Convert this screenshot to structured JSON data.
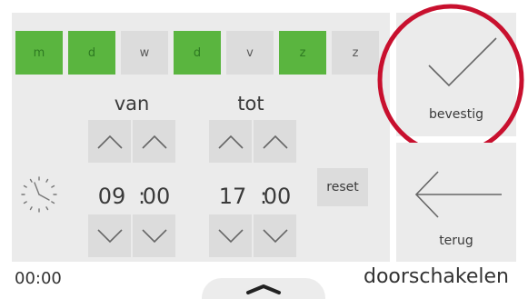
{
  "days": [
    {
      "label": "m",
      "active": true
    },
    {
      "label": "d",
      "active": true
    },
    {
      "label": "w",
      "active": false
    },
    {
      "label": "d",
      "active": true
    },
    {
      "label": "v",
      "active": false
    },
    {
      "label": "z",
      "active": true
    },
    {
      "label": "z",
      "active": false
    }
  ],
  "from": {
    "label": "van",
    "hours": "09",
    "minutes": "00"
  },
  "to": {
    "label": "tot",
    "hours": "17",
    "minutes": "00"
  },
  "separator": ":",
  "reset_label": "reset",
  "confirm_label": "bevestig",
  "back_label": "terug",
  "footer": {
    "time": "00:00",
    "title": "doorschakelen"
  },
  "colors": {
    "active_day": "#5ab53f",
    "panel": "#ebebeb",
    "button": "#dcdcdc",
    "highlight_ring": "#c8102e"
  },
  "icons": [
    "clock-icon",
    "chevron-up-icon",
    "chevron-down-icon",
    "checkmark-icon",
    "arrow-left-icon",
    "chevron-up-icon"
  ]
}
